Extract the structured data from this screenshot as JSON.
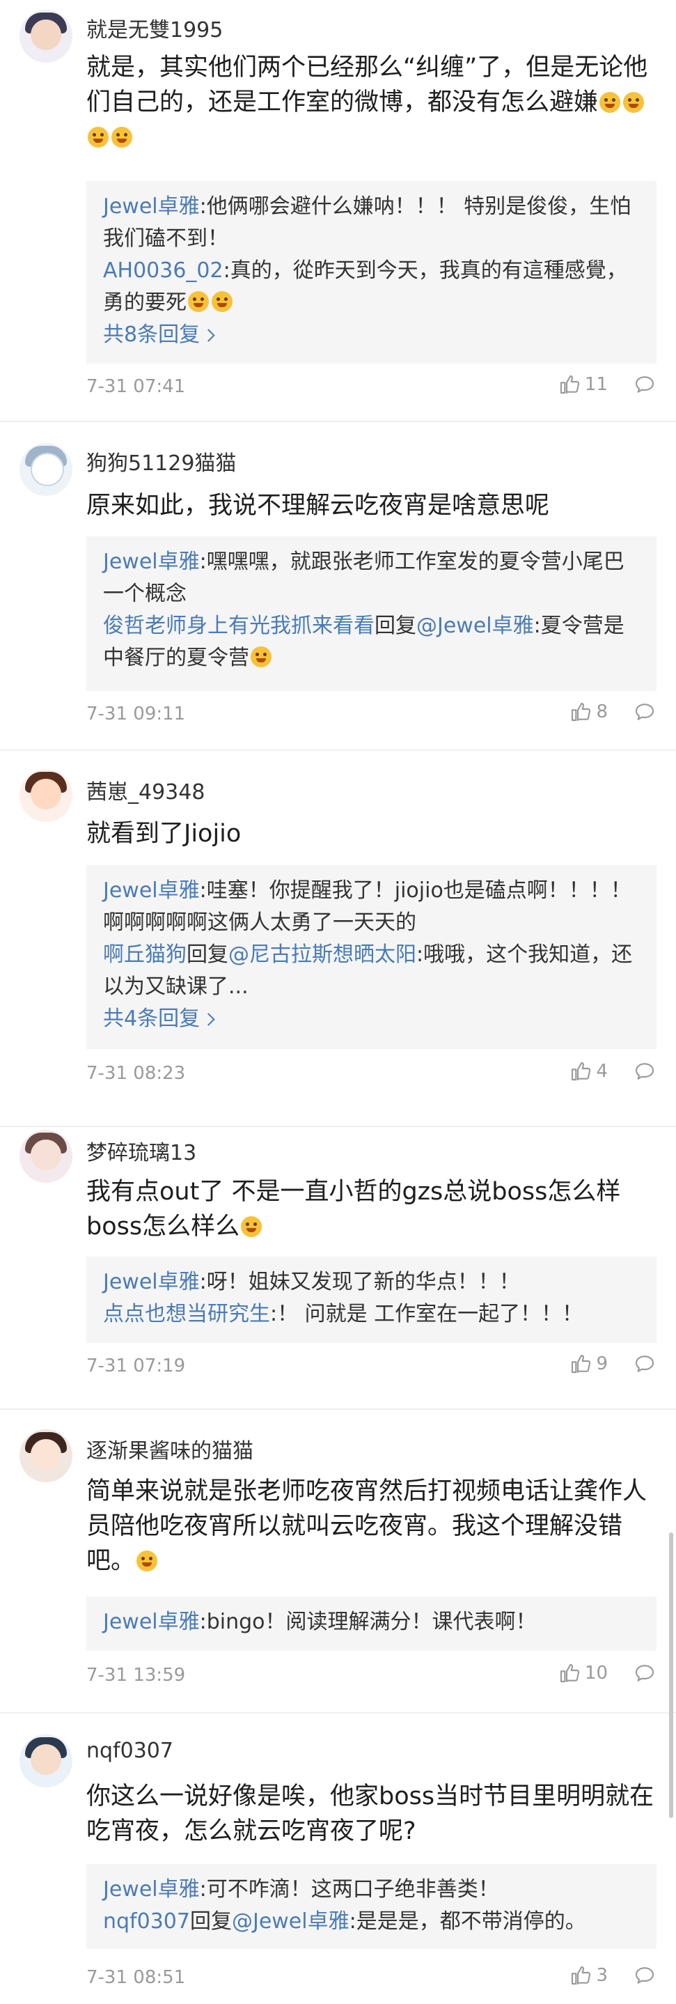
{
  "comments": [
    {
      "username": "就是无雙1995",
      "text": "就是，其实他们两个已经那么“纠缠”了，但是无论他们自己的，还是工作室的微博，都没有怎么避嫌",
      "emoji_count": 4,
      "replies": [
        {
          "name": "Jewel卓雅",
          "text": ":他俩哪会避什么嫌呐！！！ 特别是俊俊，生怕我们磕不到！",
          "to": ""
        },
        {
          "name": "AH0036_02",
          "text": ":真的，從昨天到今天，我真的有這種感覺，勇的要死",
          "to": ""
        }
      ],
      "more": "共8条回复",
      "time": "7-31 07:41",
      "likes": "11"
    },
    {
      "username": "狗狗51129猫猫",
      "text": "原来如此，我说不理解云吃夜宵是啥意思呢",
      "replies": [
        {
          "name": "Jewel卓雅",
          "text": ":嘿嘿嘿，就跟张老师工作室发的夏令营小尾巴一个概念",
          "to": ""
        },
        {
          "name": "俊哲老师身上有光我抓来看看",
          "text": ":夏令营是中餐厅的夏令营",
          "to": "@Jewel卓雅",
          "reply_word": "回复"
        }
      ],
      "more": "",
      "time": "7-31 09:11",
      "likes": "8"
    },
    {
      "username": "茜崽_49348",
      "text": "就看到了Jiojio",
      "replies": [
        {
          "name": "Jewel卓雅",
          "text": ":哇塞！你提醒我了！jiojio也是磕点啊！！！！ 啊啊啊啊啊这俩人太勇了一天天的",
          "to": ""
        },
        {
          "name": "啊丘猫狗",
          "text": ":哦哦，这个我知道，还以为又缺课了...",
          "to": "@尼古拉斯想晒太阳",
          "reply_word": "回复"
        }
      ],
      "more": "共4条回复",
      "time": "7-31 08:23",
      "likes": "4"
    },
    {
      "username": "梦碎琉璃13",
      "text": "我有点out了 不是一直小哲的gzs总说boss怎么样boss怎么样么",
      "replies": [
        {
          "name": "Jewel卓雅",
          "text": ":呀！姐妹又发现了新的华点！！！",
          "to": ""
        },
        {
          "name": "点点也想当研究生",
          "text": ":！ 问就是 工作室在一起了！！！",
          "to": ""
        }
      ],
      "more": "",
      "time": "7-31 07:19",
      "likes": "9"
    },
    {
      "username": "逐渐果酱味的猫猫",
      "text": "简单来说就是张老师吃夜宵然后打视频电话让龚作人员陪他吃夜宵所以就叫云吃夜宵。我这个理解没错吧。",
      "replies": [
        {
          "name": "Jewel卓雅",
          "text": ":bingo！阅读理解满分！课代表啊！",
          "to": ""
        }
      ],
      "more": "",
      "time": "7-31 13:59",
      "likes": "10"
    },
    {
      "username": "nqf0307",
      "text": "你这么一说好像是唉，他家boss当时节目里明明就在吃宵夜，怎么就云吃宵夜了呢?",
      "replies": [
        {
          "name": "Jewel卓雅",
          "text": ":可不咋滴！这两口子绝非善类！",
          "to": ""
        },
        {
          "name": "nqf0307",
          "text": ":是是是，都不带消停的。",
          "to": "@Jewel卓雅",
          "reply_word": "回复"
        }
      ],
      "more": "",
      "time": "7-31 08:51",
      "likes": "3"
    }
  ]
}
